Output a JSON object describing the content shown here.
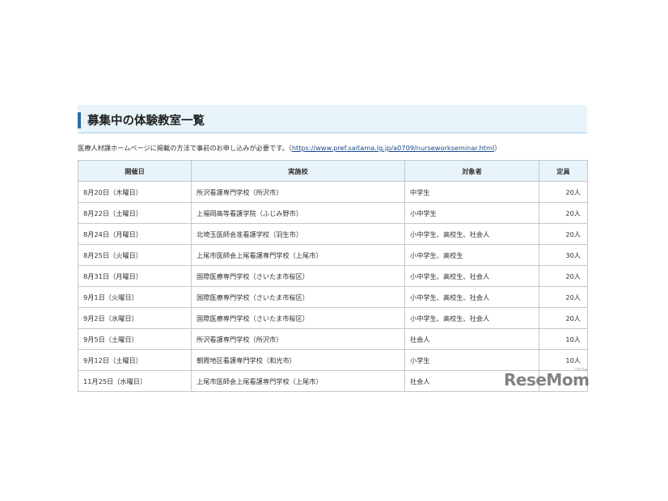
{
  "heading": "募集中の体験教室一覧",
  "intro": {
    "text_before": "医療人材課ホームページに掲載の方法で事前のお申し込みが必要です。（",
    "link": "https://www.pref.saitama.lg.jp/a0709/nurseworkseminar.html",
    "text_after": "）"
  },
  "table": {
    "headers": [
      "開催日",
      "実施校",
      "対象者",
      "定員"
    ],
    "rows": [
      {
        "date": "8月20日（木曜日）",
        "school": "所沢看護専門学校（所沢市）",
        "target": "中学生",
        "capacity": "20人"
      },
      {
        "date": "8月22日（土曜日）",
        "school": "上福岡高等看護学院（ふじみ野市）",
        "target": "小中学生",
        "capacity": "20人"
      },
      {
        "date": "8月24日（月曜日）",
        "school": "北埼玉医師会准看護学校（羽生市）",
        "target": "小中学生、高校生、社会人",
        "capacity": "20人"
      },
      {
        "date": "8月25日（火曜日）",
        "school": "上尾市医師会上尾看護専門学校（上尾市）",
        "target": "小中学生、高校生",
        "capacity": "30人"
      },
      {
        "date": "8月31日（月曜日）",
        "school": "国際医療専門学校（さいたま市桜区）",
        "target": "小中学生、高校生、社会人",
        "capacity": "20人"
      },
      {
        "date": "9月1日（火曜日）",
        "school": "国際医療専門学校（さいたま市桜区）",
        "target": "小中学生、高校生、社会人",
        "capacity": "20人"
      },
      {
        "date": "9月2日（水曜日）",
        "school": "国際医療専門学校（さいたま市桜区）",
        "target": "小中学生、高校生、社会人",
        "capacity": "20人"
      },
      {
        "date": "9月5日（土曜日）",
        "school": "所沢看護専門学校（所沢市）",
        "target": "社会人",
        "capacity": "10人"
      },
      {
        "date": "9月12日（土曜日）",
        "school": "朝霞地区看護専門学校（和光市）",
        "target": "小学生",
        "capacity": "10人"
      },
      {
        "date": "11月25日（水曜日）",
        "school": "上尾市医師会上尾看護専門学校（上尾市）",
        "target": "社会人",
        "capacity": ""
      }
    ]
  },
  "watermark": {
    "text": "ReseMom",
    "small": "リセマム"
  }
}
